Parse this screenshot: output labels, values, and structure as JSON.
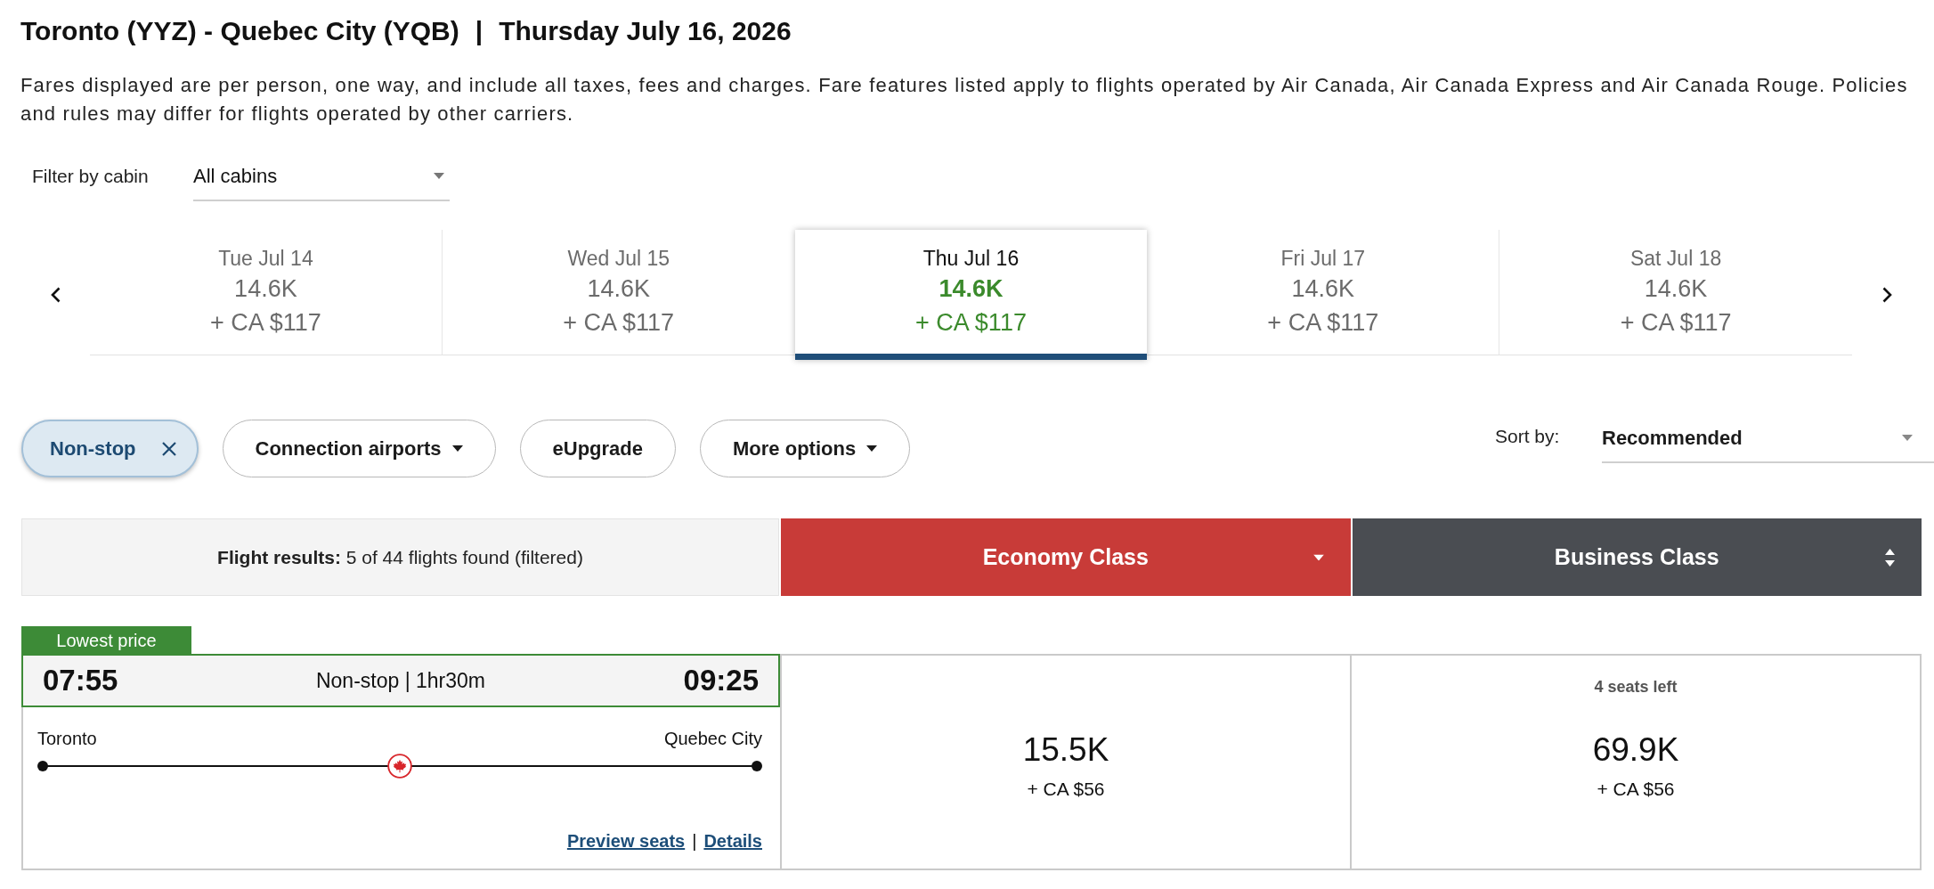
{
  "title": {
    "route": "Toronto (YYZ) - Quebec City (YQB)",
    "separator": "|",
    "date": "Thursday July 16, 2026"
  },
  "notice": "Fares displayed are per person, one way, and include all taxes, fees and charges. Fare features listed apply to flights operated by Air Canada, Air Canada Express and Air Canada Rouge. Policies and rules may differ for flights operated by other carriers.",
  "cabin_filter": {
    "label": "Filter by cabin",
    "value": "All cabins"
  },
  "date_tabs": [
    {
      "date": "Tue Jul 14",
      "points": "14.6K",
      "taxes": "+ CA $117",
      "selected": false
    },
    {
      "date": "Wed Jul 15",
      "points": "14.6K",
      "taxes": "+ CA $117",
      "selected": false
    },
    {
      "date": "Thu Jul 16",
      "points": "14.6K",
      "taxes": "+ CA $117",
      "selected": true
    },
    {
      "date": "Fri Jul 17",
      "points": "14.6K",
      "taxes": "+ CA $117",
      "selected": false
    },
    {
      "date": "Sat Jul 18",
      "points": "14.6K",
      "taxes": "+ CA $117",
      "selected": false
    }
  ],
  "filters": [
    {
      "label": "Non-stop",
      "kind": "removable",
      "selected": true
    },
    {
      "label": "Connection airports",
      "kind": "dropdown",
      "selected": false
    },
    {
      "label": "eUpgrade",
      "kind": "toggle",
      "selected": false
    },
    {
      "label": "More options",
      "kind": "dropdown",
      "selected": false
    }
  ],
  "sort": {
    "label": "Sort by:",
    "value": "Recommended"
  },
  "results": {
    "summary": "**Flight results:** 5 of 44 flights found (filtered)"
  },
  "cabins": [
    {
      "label": "Economy Class",
      "color": "#c83b38",
      "sorted": true
    },
    {
      "label": "Business Class",
      "color": "#4a4d52",
      "sorted": false
    }
  ],
  "flights": [
    {
      "badge": "Lowest price",
      "depart_time": "07:55",
      "summary": "Non-stop | 1hr30m",
      "arrive_time": "09:25",
      "origin": "Toronto",
      "destination": "Quebec City",
      "links": [
        "Preview seats",
        "Details"
      ],
      "link_separator": "|",
      "fares": [
        {
          "points": "15.5K",
          "taxes": "+ CA $56"
        },
        {
          "note": "4 seats left",
          "points": "69.9K",
          "taxes": "+ CA $56"
        }
      ]
    }
  ]
}
